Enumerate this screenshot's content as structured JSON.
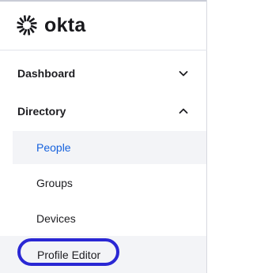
{
  "brand": {
    "name": "okta",
    "logo_icon": "okta-sunburst-icon"
  },
  "nav": {
    "sections": [
      {
        "label": "Dashboard",
        "expanded": false,
        "icon": "chevron-down-icon"
      },
      {
        "label": "Directory",
        "expanded": true,
        "icon": "chevron-up-icon"
      }
    ],
    "directory_items": [
      {
        "label": "People",
        "active": true
      },
      {
        "label": "Groups",
        "active": false
      },
      {
        "label": "Devices",
        "active": false
      },
      {
        "label": "Profile Editor",
        "active": false,
        "highlighted": true
      }
    ]
  },
  "colors": {
    "active_text": "#1662dd",
    "highlight_ring": "#2a27d4",
    "active_background": "#f3f4f7"
  }
}
